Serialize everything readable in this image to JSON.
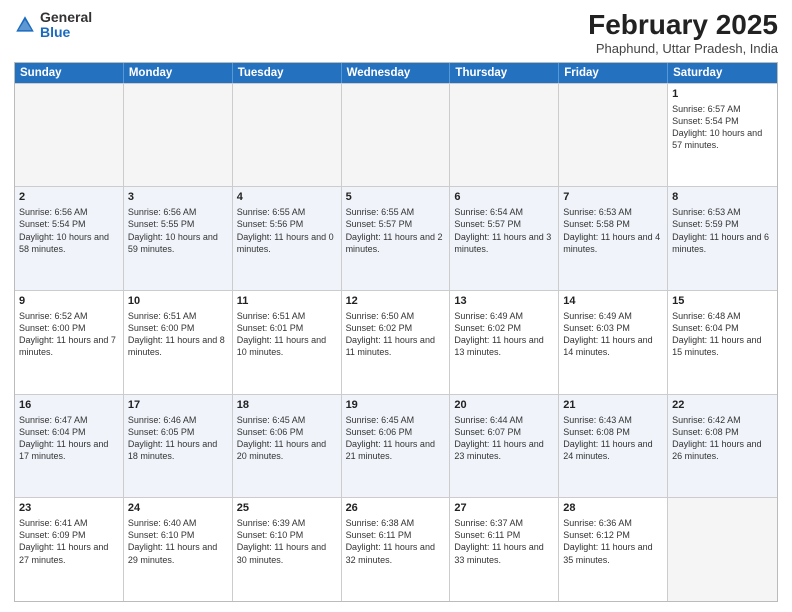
{
  "logo": {
    "general": "General",
    "blue": "Blue"
  },
  "header": {
    "month": "February 2025",
    "location": "Phaphund, Uttar Pradesh, India"
  },
  "weekdays": [
    "Sunday",
    "Monday",
    "Tuesday",
    "Wednesday",
    "Thursday",
    "Friday",
    "Saturday"
  ],
  "rows": [
    [
      {
        "day": "",
        "info": "",
        "empty": true
      },
      {
        "day": "",
        "info": "",
        "empty": true
      },
      {
        "day": "",
        "info": "",
        "empty": true
      },
      {
        "day": "",
        "info": "",
        "empty": true
      },
      {
        "day": "",
        "info": "",
        "empty": true
      },
      {
        "day": "",
        "info": "",
        "empty": true
      },
      {
        "day": "1",
        "info": "Sunrise: 6:57 AM\nSunset: 5:54 PM\nDaylight: 10 hours and 57 minutes.",
        "empty": false
      }
    ],
    [
      {
        "day": "2",
        "info": "Sunrise: 6:56 AM\nSunset: 5:54 PM\nDaylight: 10 hours and 58 minutes.",
        "empty": false
      },
      {
        "day": "3",
        "info": "Sunrise: 6:56 AM\nSunset: 5:55 PM\nDaylight: 10 hours and 59 minutes.",
        "empty": false
      },
      {
        "day": "4",
        "info": "Sunrise: 6:55 AM\nSunset: 5:56 PM\nDaylight: 11 hours and 0 minutes.",
        "empty": false
      },
      {
        "day": "5",
        "info": "Sunrise: 6:55 AM\nSunset: 5:57 PM\nDaylight: 11 hours and 2 minutes.",
        "empty": false
      },
      {
        "day": "6",
        "info": "Sunrise: 6:54 AM\nSunset: 5:57 PM\nDaylight: 11 hours and 3 minutes.",
        "empty": false
      },
      {
        "day": "7",
        "info": "Sunrise: 6:53 AM\nSunset: 5:58 PM\nDaylight: 11 hours and 4 minutes.",
        "empty": false
      },
      {
        "day": "8",
        "info": "Sunrise: 6:53 AM\nSunset: 5:59 PM\nDaylight: 11 hours and 6 minutes.",
        "empty": false
      }
    ],
    [
      {
        "day": "9",
        "info": "Sunrise: 6:52 AM\nSunset: 6:00 PM\nDaylight: 11 hours and 7 minutes.",
        "empty": false
      },
      {
        "day": "10",
        "info": "Sunrise: 6:51 AM\nSunset: 6:00 PM\nDaylight: 11 hours and 8 minutes.",
        "empty": false
      },
      {
        "day": "11",
        "info": "Sunrise: 6:51 AM\nSunset: 6:01 PM\nDaylight: 11 hours and 10 minutes.",
        "empty": false
      },
      {
        "day": "12",
        "info": "Sunrise: 6:50 AM\nSunset: 6:02 PM\nDaylight: 11 hours and 11 minutes.",
        "empty": false
      },
      {
        "day": "13",
        "info": "Sunrise: 6:49 AM\nSunset: 6:02 PM\nDaylight: 11 hours and 13 minutes.",
        "empty": false
      },
      {
        "day": "14",
        "info": "Sunrise: 6:49 AM\nSunset: 6:03 PM\nDaylight: 11 hours and 14 minutes.",
        "empty": false
      },
      {
        "day": "15",
        "info": "Sunrise: 6:48 AM\nSunset: 6:04 PM\nDaylight: 11 hours and 15 minutes.",
        "empty": false
      }
    ],
    [
      {
        "day": "16",
        "info": "Sunrise: 6:47 AM\nSunset: 6:04 PM\nDaylight: 11 hours and 17 minutes.",
        "empty": false
      },
      {
        "day": "17",
        "info": "Sunrise: 6:46 AM\nSunset: 6:05 PM\nDaylight: 11 hours and 18 minutes.",
        "empty": false
      },
      {
        "day": "18",
        "info": "Sunrise: 6:45 AM\nSunset: 6:06 PM\nDaylight: 11 hours and 20 minutes.",
        "empty": false
      },
      {
        "day": "19",
        "info": "Sunrise: 6:45 AM\nSunset: 6:06 PM\nDaylight: 11 hours and 21 minutes.",
        "empty": false
      },
      {
        "day": "20",
        "info": "Sunrise: 6:44 AM\nSunset: 6:07 PM\nDaylight: 11 hours and 23 minutes.",
        "empty": false
      },
      {
        "day": "21",
        "info": "Sunrise: 6:43 AM\nSunset: 6:08 PM\nDaylight: 11 hours and 24 minutes.",
        "empty": false
      },
      {
        "day": "22",
        "info": "Sunrise: 6:42 AM\nSunset: 6:08 PM\nDaylight: 11 hours and 26 minutes.",
        "empty": false
      }
    ],
    [
      {
        "day": "23",
        "info": "Sunrise: 6:41 AM\nSunset: 6:09 PM\nDaylight: 11 hours and 27 minutes.",
        "empty": false
      },
      {
        "day": "24",
        "info": "Sunrise: 6:40 AM\nSunset: 6:10 PM\nDaylight: 11 hours and 29 minutes.",
        "empty": false
      },
      {
        "day": "25",
        "info": "Sunrise: 6:39 AM\nSunset: 6:10 PM\nDaylight: 11 hours and 30 minutes.",
        "empty": false
      },
      {
        "day": "26",
        "info": "Sunrise: 6:38 AM\nSunset: 6:11 PM\nDaylight: 11 hours and 32 minutes.",
        "empty": false
      },
      {
        "day": "27",
        "info": "Sunrise: 6:37 AM\nSunset: 6:11 PM\nDaylight: 11 hours and 33 minutes.",
        "empty": false
      },
      {
        "day": "28",
        "info": "Sunrise: 6:36 AM\nSunset: 6:12 PM\nDaylight: 11 hours and 35 minutes.",
        "empty": false
      },
      {
        "day": "",
        "info": "",
        "empty": true
      }
    ]
  ]
}
